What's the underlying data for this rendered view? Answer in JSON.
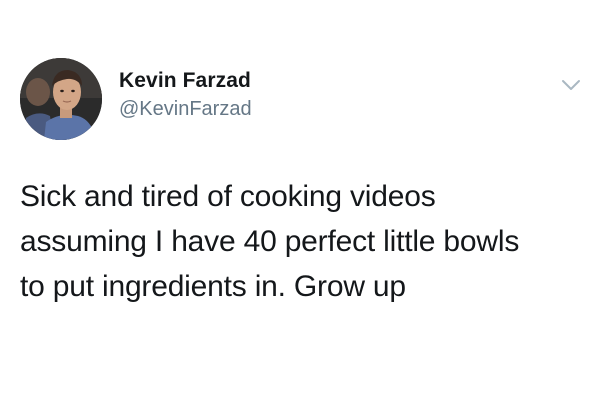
{
  "tweet": {
    "author": {
      "display_name": "Kevin Farzad",
      "handle": "@KevinFarzad",
      "avatar_icon": "user-avatar-photo"
    },
    "menu_icon": "chevron-down-icon",
    "text_lines": [
      "Sick and tired of cooking videos",
      "assuming I have 40 perfect little bowls",
      "to put ingredients in. Grow up"
    ]
  },
  "colors": {
    "text": "#14171a",
    "handle": "#657786",
    "caret": "#aab8c2",
    "background": "#ffffff"
  }
}
